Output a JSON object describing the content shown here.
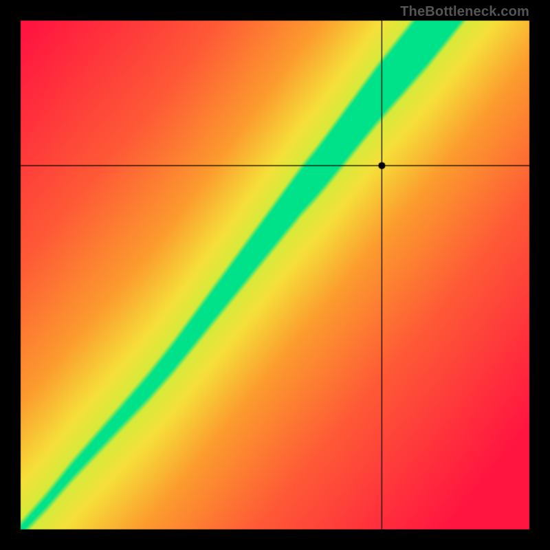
{
  "watermark": "TheBottleneck.com",
  "chart_data": {
    "type": "heatmap",
    "title": "",
    "xlabel": "",
    "ylabel": "",
    "xlim": [
      0,
      1
    ],
    "ylim": [
      0,
      1
    ],
    "grid": false,
    "legend": false,
    "outer_border": {
      "color": "#000000",
      "thickness": 30
    },
    "crosshair": {
      "x": 0.71,
      "y": 0.715,
      "marker_radius_px": 5,
      "color": "#000000"
    },
    "distance_field": {
      "description": "Color encodes |y - f(x)| distance from a monotone curve that starts at the lower-left corner, rises roughly linearly with a mild S-bend, and exits near the top edge around x≈0.82. Green = on-curve, yellow = near, orange/red = far.",
      "color_stops": [
        {
          "d": 0.0,
          "color": "#00E28A"
        },
        {
          "d": 0.035,
          "color": "#00E28A"
        },
        {
          "d": 0.05,
          "color": "#D6EA3A"
        },
        {
          "d": 0.12,
          "color": "#F6E03A"
        },
        {
          "d": 0.28,
          "color": "#FC9B2E"
        },
        {
          "d": 0.55,
          "color": "#FE5A36"
        },
        {
          "d": 1.0,
          "color": "#FF1540"
        }
      ],
      "curve_samples": [
        {
          "x": 0.0,
          "y": 0.0
        },
        {
          "x": 0.05,
          "y": 0.055
        },
        {
          "x": 0.1,
          "y": 0.115
        },
        {
          "x": 0.15,
          "y": 0.17
        },
        {
          "x": 0.2,
          "y": 0.225
        },
        {
          "x": 0.25,
          "y": 0.28
        },
        {
          "x": 0.3,
          "y": 0.34
        },
        {
          "x": 0.35,
          "y": 0.405
        },
        {
          "x": 0.4,
          "y": 0.47
        },
        {
          "x": 0.45,
          "y": 0.535
        },
        {
          "x": 0.5,
          "y": 0.6
        },
        {
          "x": 0.55,
          "y": 0.665
        },
        {
          "x": 0.58,
          "y": 0.7
        },
        {
          "x": 0.6,
          "y": 0.725
        },
        {
          "x": 0.65,
          "y": 0.79
        },
        {
          "x": 0.7,
          "y": 0.855
        },
        {
          "x": 0.75,
          "y": 0.915
        },
        {
          "x": 0.8,
          "y": 0.975
        },
        {
          "x": 0.82,
          "y": 1.0
        }
      ],
      "band_halfwidth": {
        "description": "approximate half-width of the pure-green band as a function of x",
        "samples": [
          {
            "x": 0.0,
            "w": 0.005
          },
          {
            "x": 0.2,
            "w": 0.015
          },
          {
            "x": 0.4,
            "w": 0.028
          },
          {
            "x": 0.6,
            "w": 0.042
          },
          {
            "x": 0.8,
            "w": 0.055
          },
          {
            "x": 1.0,
            "w": 0.055
          }
        ]
      }
    }
  }
}
